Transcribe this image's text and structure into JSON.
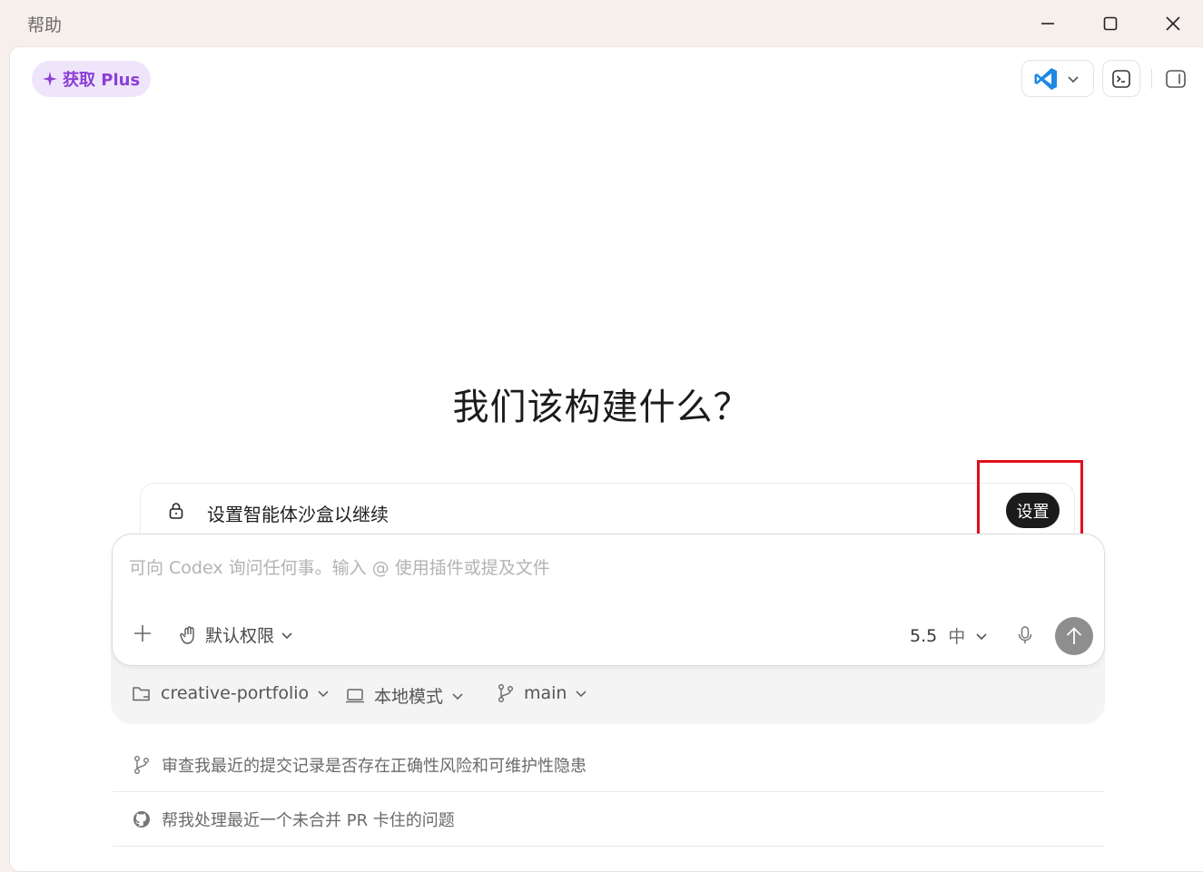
{
  "titlebar": {
    "menu_label": "帮助",
    "minimize_icon": "minimize-icon",
    "maximize_icon": "maximize-icon",
    "close_icon": "close-icon"
  },
  "header": {
    "upgrade_label": "获取 Plus",
    "editor_icon": "vscode-icon",
    "terminal_icon": "terminal-icon",
    "sidebar_icon": "sidebar-toggle-icon"
  },
  "main": {
    "headline": "我们该构建什么？",
    "sandbox_notice": {
      "text": "设置智能体沙盒以继续",
      "button_label": "设置"
    },
    "composer": {
      "placeholder": "可向 Codex 询问任何事。输入 @ 使用插件或提及文件",
      "permission_label": "默认权限",
      "model_version": "5.5",
      "effort_label": "中"
    },
    "context": {
      "project": "creative-portfolio",
      "mode": "本地模式",
      "branch": "main"
    },
    "suggestions": [
      {
        "icon": "git-branch-icon",
        "text": "审查我最近的提交记录是否存在正确性风险和可维护性隐患"
      },
      {
        "icon": "github-icon",
        "text": "帮我处理最近一个未合并 PR 卡住的问题"
      }
    ]
  },
  "colors": {
    "accent_purple": "#8b3fd6",
    "highlight_red": "#e0101c",
    "vscode_blue": "#1e88e5"
  }
}
